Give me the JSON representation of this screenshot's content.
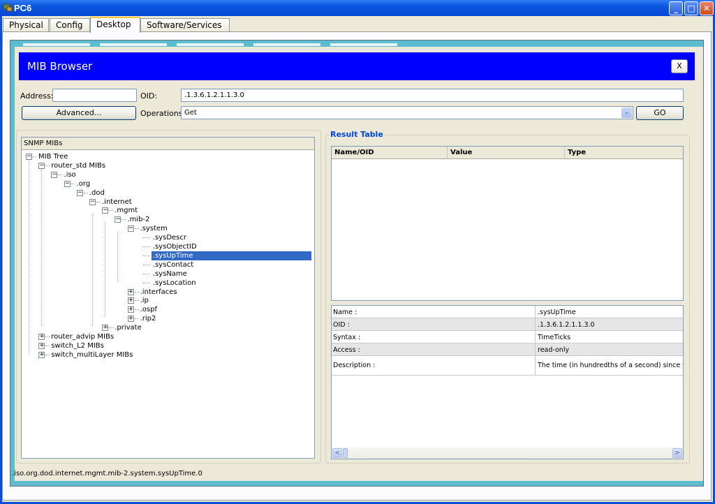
{
  "window": {
    "title": "PC6",
    "controls": {
      "minimize": "_",
      "maximize": "□",
      "close": "✕"
    }
  },
  "tabs": [
    {
      "label": "Physical",
      "active": false
    },
    {
      "label": "Config",
      "active": false
    },
    {
      "label": "Desktop",
      "active": true
    },
    {
      "label": "Software/Services",
      "active": false
    }
  ],
  "app": {
    "title": "MIB Browser",
    "close_label": "X",
    "address_label": "Address:",
    "address_value": "",
    "oid_label": "OID:",
    "oid_value": ".1.3.6.1.2.1.1.3.0",
    "advanced_label": "Advanced...",
    "operations_label": "Operations:",
    "operations_value": "Get",
    "go_label": "GO"
  },
  "tree": {
    "header": "SNMP MIBs",
    "nodes": [
      {
        "label": "MIB Tree",
        "toggle": "−",
        "selected": false
      },
      {
        "label": "router_std MIBs",
        "toggle": "−",
        "selected": false
      },
      {
        "label": ".iso",
        "toggle": "−",
        "selected": false
      },
      {
        "label": ".org",
        "toggle": "−",
        "selected": false
      },
      {
        "label": ".dod",
        "toggle": "−",
        "selected": false
      },
      {
        "label": ".internet",
        "toggle": "−",
        "selected": false
      },
      {
        "label": ".mgmt",
        "toggle": "−",
        "selected": false
      },
      {
        "label": ".mib-2",
        "toggle": "−",
        "selected": false
      },
      {
        "label": ".system",
        "toggle": "−",
        "selected": false
      },
      {
        "label": ".sysDescr",
        "toggle": "",
        "selected": false
      },
      {
        "label": ".sysObjectID",
        "toggle": "",
        "selected": false
      },
      {
        "label": ".sysUpTime",
        "toggle": "",
        "selected": true
      },
      {
        "label": ".sysContact",
        "toggle": "",
        "selected": false
      },
      {
        "label": ".sysName",
        "toggle": "",
        "selected": false
      },
      {
        "label": ".sysLocation",
        "toggle": "",
        "selected": false
      },
      {
        "label": ".interfaces",
        "toggle": "+",
        "selected": false
      },
      {
        "label": ".ip",
        "toggle": "+",
        "selected": false
      },
      {
        "label": ".ospf",
        "toggle": "+",
        "selected": false
      },
      {
        "label": ".rip2",
        "toggle": "+",
        "selected": false
      },
      {
        "label": ".private",
        "toggle": "+",
        "selected": false
      },
      {
        "label": "router_advip MIBs",
        "toggle": "+",
        "selected": false
      },
      {
        "label": "switch_L2 MIBs",
        "toggle": "+",
        "selected": false
      },
      {
        "label": "switch_multiLayer MIBs",
        "toggle": "+",
        "selected": false
      }
    ]
  },
  "result": {
    "legend": "Result Table",
    "columns": [
      "Name/OID",
      "Value",
      "Type"
    ],
    "rows": []
  },
  "details": [
    {
      "key": "Name :",
      "value": ".sysUpTime"
    },
    {
      "key": "OID :",
      "value": ".1.3.6.1.2.1.1.3.0"
    },
    {
      "key": "Syntax :",
      "value": "TimeTicks"
    },
    {
      "key": "Access :",
      "value": "read-only"
    },
    {
      "key": "Description :",
      "value": "The time (in hundredths of a second) since the n"
    }
  ],
  "scroll": {
    "left": "<",
    "right": ">"
  },
  "status": ".iso.org.dod.internet.mgmt.mib-2.system.sysUpTime.0",
  "colors": {
    "header_blue": "#0000fe",
    "selection": "#316ac5",
    "legend_text": "#0046d5",
    "desktop_frame": "#5cbcd0"
  }
}
